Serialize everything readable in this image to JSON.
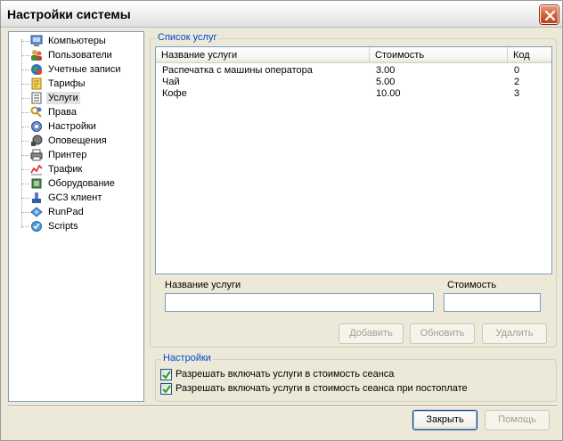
{
  "window": {
    "title": "Настройки системы"
  },
  "tree": {
    "items": [
      {
        "label": "Компьютеры",
        "icon": "computers-icon"
      },
      {
        "label": "Пользователи",
        "icon": "users-icon"
      },
      {
        "label": "Учетные записи",
        "icon": "accounts-icon"
      },
      {
        "label": "Тарифы",
        "icon": "tariffs-icon"
      },
      {
        "label": "Услуги",
        "icon": "services-icon",
        "selected": true
      },
      {
        "label": "Права",
        "icon": "rights-icon"
      },
      {
        "label": "Настройки",
        "icon": "settings-icon"
      },
      {
        "label": "Оповещения",
        "icon": "notifications-icon"
      },
      {
        "label": "Принтер",
        "icon": "printer-icon"
      },
      {
        "label": "Трафик",
        "icon": "traffic-icon"
      },
      {
        "label": "Оборудование",
        "icon": "hardware-icon"
      },
      {
        "label": "GC3 клиент",
        "icon": "gc3-client-icon"
      },
      {
        "label": "RunPad",
        "icon": "runpad-icon"
      },
      {
        "label": "Scripts",
        "icon": "scripts-icon"
      }
    ]
  },
  "services": {
    "group_title": "Список услуг",
    "columns": [
      "Название услуги",
      "Стоимость",
      "Код"
    ],
    "rows": [
      [
        "Распечатка с машины оператора",
        "3.00",
        "0"
      ],
      [
        "Чай",
        "5.00",
        "2"
      ],
      [
        "Кофе",
        "10.00",
        "3"
      ]
    ],
    "name_label": "Название услуги",
    "name_value": "",
    "cost_label": "Стоимость",
    "cost_value": "",
    "add_label": "Добавить",
    "update_label": "Обновить",
    "delete_label": "Удалить"
  },
  "settings": {
    "group_title": "Настройки",
    "options": [
      {
        "label": "Разрешать включать услуги в стоимость сеанса",
        "checked": true
      },
      {
        "label": "Разрешать включать услуги в стоимость сеанса при постоплате",
        "checked": true
      }
    ]
  },
  "footer": {
    "close_label": "Закрыть",
    "help_label": "Помощь"
  },
  "colors": {
    "accent": "#0046d5",
    "close_button": "#c1401c",
    "border": "#7f9db9"
  }
}
